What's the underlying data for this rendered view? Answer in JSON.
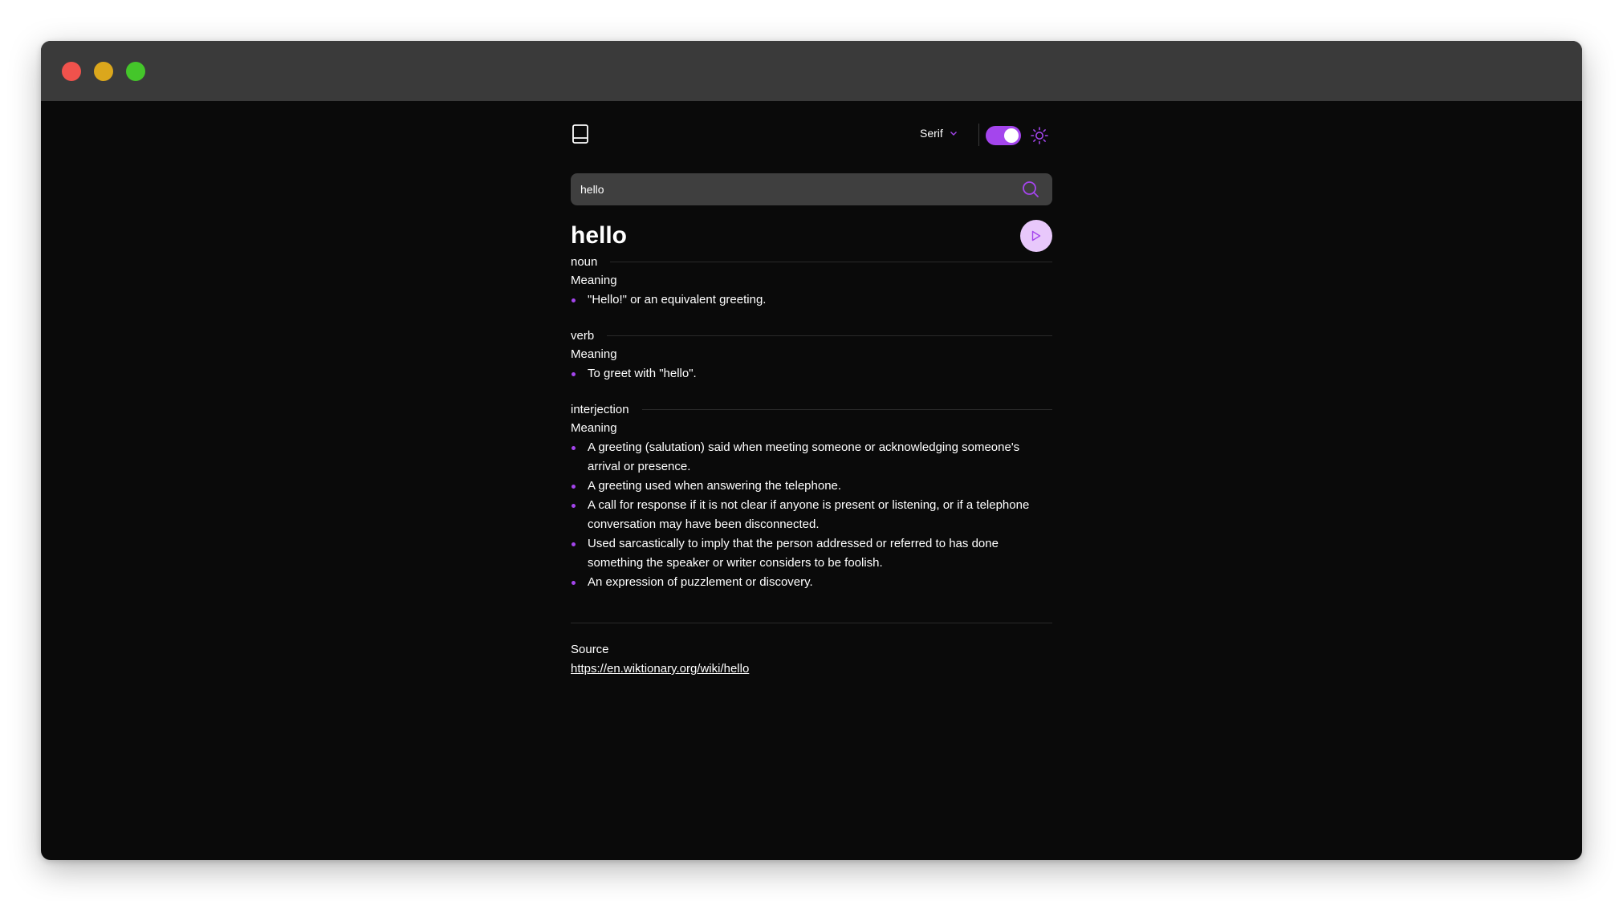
{
  "window": {
    "controls": [
      "close",
      "minimize",
      "maximize"
    ]
  },
  "header": {
    "logo_icon": "book-icon",
    "font_selector": "Serif",
    "theme_toggle": {
      "state": "on",
      "color": "#a445ed"
    },
    "theme_icon": "sun-icon"
  },
  "search": {
    "value": "hello",
    "icon": "search-icon"
  },
  "entry": {
    "word": "hello",
    "play_icon": "play-icon",
    "meanings": [
      {
        "part_of_speech": "noun",
        "heading": "Meaning",
        "definitions": [
          "\"Hello!\" or an equivalent greeting."
        ]
      },
      {
        "part_of_speech": "verb",
        "heading": "Meaning",
        "definitions": [
          "To greet with \"hello\"."
        ]
      },
      {
        "part_of_speech": "interjection",
        "heading": "Meaning",
        "definitions": [
          "A greeting (salutation) said when meeting someone or acknowledging someone's arrival or presence.",
          "A greeting used when answering the telephone.",
          "A call for response if it is not clear if anyone is present or listening, or if a telephone conversation may have been disconnected.",
          "Used sarcastically to imply that the person addressed or referred to has done something the speaker or writer considers to be foolish.",
          "An expression of puzzlement or discovery."
        ]
      }
    ]
  },
  "source": {
    "label": "Source",
    "url": "https://en.wiktionary.org/wiki/hello"
  },
  "colors": {
    "accent": "#a445ed",
    "background": "#0a0a0a",
    "titlebar": "#3a3a3a",
    "search_bg": "#3f3f3f"
  }
}
